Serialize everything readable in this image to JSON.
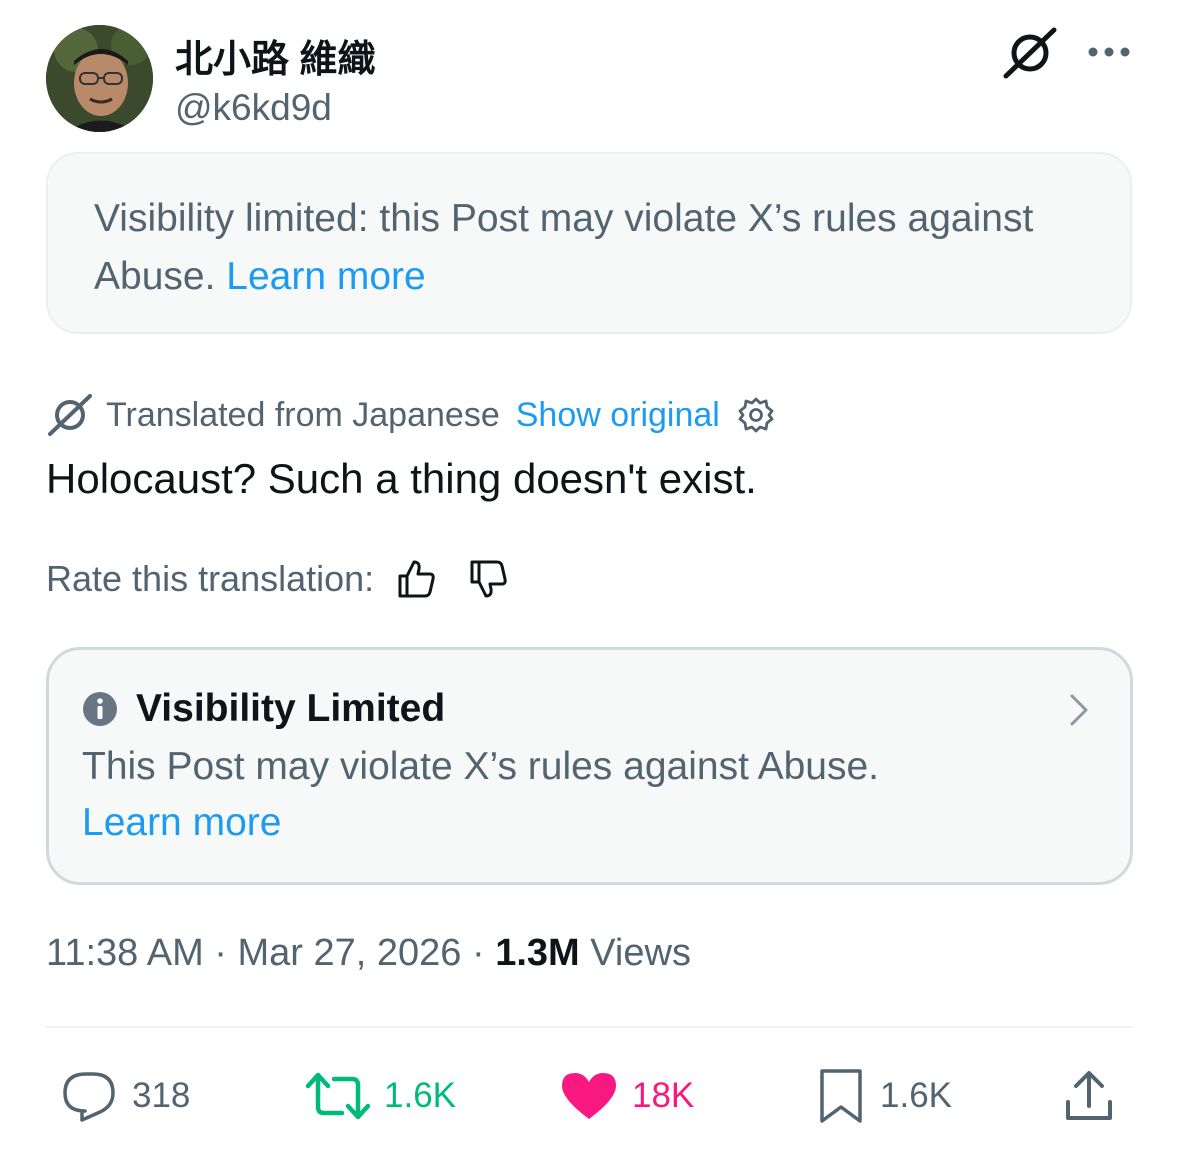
{
  "author": {
    "display_name": "北小路 維織",
    "handle": "@k6kd9d",
    "avatar_icon": "profile-photo"
  },
  "header_icons": [
    "grok-icon",
    "more-options-icon"
  ],
  "notice": {
    "text": "Visibility limited: this Post may violate X’s rules against Abuse.",
    "link": "Learn more"
  },
  "translation": {
    "label": "Translated from Japanese",
    "show_original": "Show original",
    "icon": "grok-icon",
    "settings_icon": "gear-icon"
  },
  "post": {
    "text": "Holocaust? Such a thing doesn't exist."
  },
  "rate": {
    "label": "Rate this translation:",
    "icons": [
      "thumbs-up-icon",
      "thumbs-down-icon"
    ]
  },
  "visibility_box": {
    "title": "Visibility Limited",
    "body": "This Post may violate X’s rules against Abuse.",
    "link": "Learn more",
    "icon": "info-icon"
  },
  "meta": {
    "time": "11:38 AM",
    "sep": "·",
    "date": "Mar 27, 2026",
    "views_count": "1.3M",
    "views_label": "Views"
  },
  "actions": {
    "replies": "318",
    "reposts": "1.6K",
    "likes": "18K",
    "bookmarks": "1.6K"
  },
  "colors": {
    "accent": "#1d9bf0",
    "secondary_text": "#536471",
    "repost": "#00ba7c",
    "like": "#f91880"
  }
}
